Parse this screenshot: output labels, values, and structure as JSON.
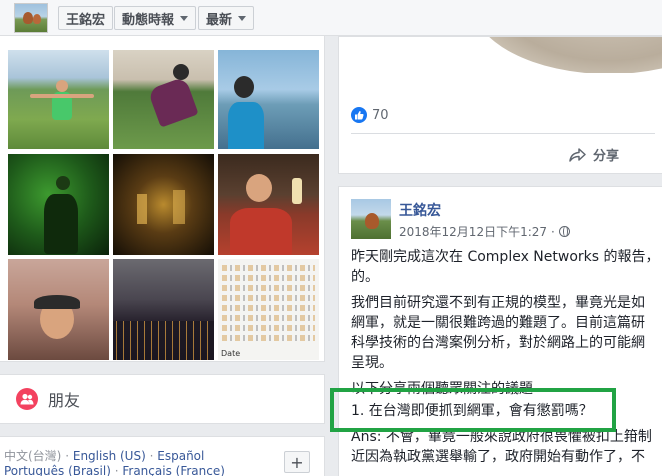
{
  "header": {
    "profile_name": "王銘宏",
    "menu_activity": "動態時報",
    "menu_sort": "最新"
  },
  "photos": {
    "p9_axis_label": "Date"
  },
  "friends": {
    "title": "朋友"
  },
  "languages": {
    "current": "中文(台灣)",
    "separator": "·",
    "items": [
      "English (US)",
      "Español",
      "Português (Brasil)",
      "Français (France)"
    ],
    "add": "+"
  },
  "prev_post": {
    "likes": "70",
    "share": "分享"
  },
  "post": {
    "author": "王銘宏",
    "timestamp": "2018年12月12日下午1:27",
    "dot": "·",
    "para1_a": "昨天剛完成這次在 Complex Networks 的報告，",
    "para1_b": "的。",
    "para2_a": "我們目前研究還不到有正規的模型，畢竟光是如",
    "para2_b": "網軍，就是一關很難跨過的難題了。目前這篇研",
    "para2_c": "科學技術的台灣案例分析，對於網路上的可能網",
    "para2_d": "呈現。",
    "para3": "以下分享兩個聽眾關注的議題",
    "question1": "1. 在台灣即便抓到網軍，會有懲罰嗎？",
    "answer_a": "Ans: 不會，畢竟一般來說政府很畏懼被扣上箝制",
    "answer_b": "近因為執政黨選舉輸了，政府開始有動作了，不"
  },
  "colors": {
    "accent_link": "#385898",
    "highlight_box": "#21a344",
    "friends_icon": "#f3425f",
    "like_icon": "#1877f2"
  }
}
